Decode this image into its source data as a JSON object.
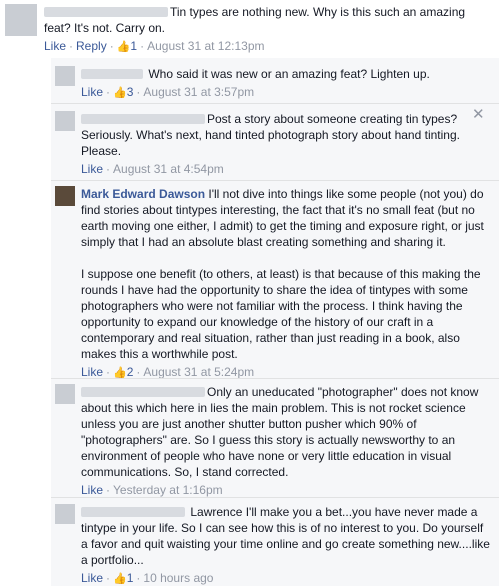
{
  "top_comment": {
    "text": "Tin types are nothing new. Why is this such an amazing feat? It's not. Carry on.",
    "like": "Like",
    "reply": "Reply",
    "likes": "1",
    "time": "August 31 at 12:13pm"
  },
  "replies": [
    {
      "text": "Who said it was new or an amazing feat? Lighten up.",
      "like": "Like",
      "likes": "3",
      "time": "August 31 at 3:57pm"
    },
    {
      "text": "Post a story about someone creating tin types? Seriously. What's next, hand tinted photograph story about hand tinting. Please.",
      "like": "Like",
      "time": "August 31 at 4:54pm"
    },
    {
      "author": "Mark Edward Dawson",
      "text_p1": "I'll not dive into things like some people (not you) do find stories about tintypes interesting, the fact that it's no small feat (but no earth moving one either, I admit) to get the timing and exposure right, or just simply that I had an absolute blast creating something and sharing it.",
      "text_p2": "I suppose one benefit (to others, at least) is that because of this making the rounds I have had the opportunity to share the idea of tintypes with some photographers who were not familiar with the process. I think having the opportunity to expand our knowledge of the history of our craft in a contemporary and real situation, rather than just reading in a book, also makes this a worthwhile post.",
      "like": "Like",
      "likes": "2",
      "time": "August 31 at 5:24pm"
    },
    {
      "text": "Only an uneducated \"photographer\" does not know about this which here in lies the main problem. This is not rocket science unless you are just another shutter button pusher which 90% of \"photographers\" are. So I guess this story is actually newsworthy to an environment of people who have none or very little education in visual communications. So, I stand corrected.",
      "like": "Like",
      "time": "Yesterday at 1:16pm"
    },
    {
      "text": "Lawrence I'll make you a bet...you have never made a tintype in your life. So I can see how this is of no interest to you. Do yourself a favor and quit waisting your time online and go create something new....like a portfolio...",
      "like": "Like",
      "likes": "1",
      "time": "10 hours ago"
    }
  ],
  "icons": {
    "thumb": "thumbs-up-icon",
    "close": "close-icon"
  },
  "colors": {
    "link": "#3b5998",
    "meta": "#9197a3",
    "text": "#141823",
    "reply_bg": "#f6f7f9"
  }
}
